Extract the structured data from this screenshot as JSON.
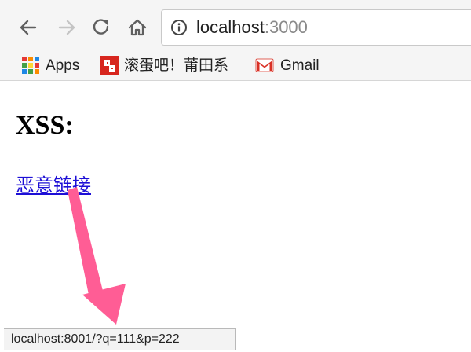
{
  "browser": {
    "address_bar": {
      "host": "localhost",
      "port_suffix": ":3000"
    },
    "icons": {
      "back": "back-arrow-icon",
      "forward": "forward-arrow-icon",
      "reload": "reload-icon",
      "home": "home-icon",
      "site_info": "info-circle-icon"
    },
    "bookmarks": [
      {
        "label": "Apps",
        "icon": "apps-grid-icon"
      },
      {
        "label": "滚蛋吧！莆田系",
        "icon": "site-favicon"
      },
      {
        "label": "Gmail",
        "icon": "gmail-icon"
      }
    ],
    "status_bar": {
      "url": "localhost:8001/?q=111&p=222"
    }
  },
  "page": {
    "heading": "XSS:",
    "link_text": "恶意链接"
  },
  "annotation": {
    "arrow_color": "#ff5d95"
  },
  "colors": {
    "toolbar_bg": "#f5f5f5",
    "link": "#1d0fd6",
    "apps_grid": [
      "#e53935",
      "#fb8c00",
      "#1e88e5",
      "#43a047",
      "#fdd835",
      "#e53935",
      "#1e88e5",
      "#43a047",
      "#fb8c00"
    ],
    "gmail_red": "#d93025"
  }
}
